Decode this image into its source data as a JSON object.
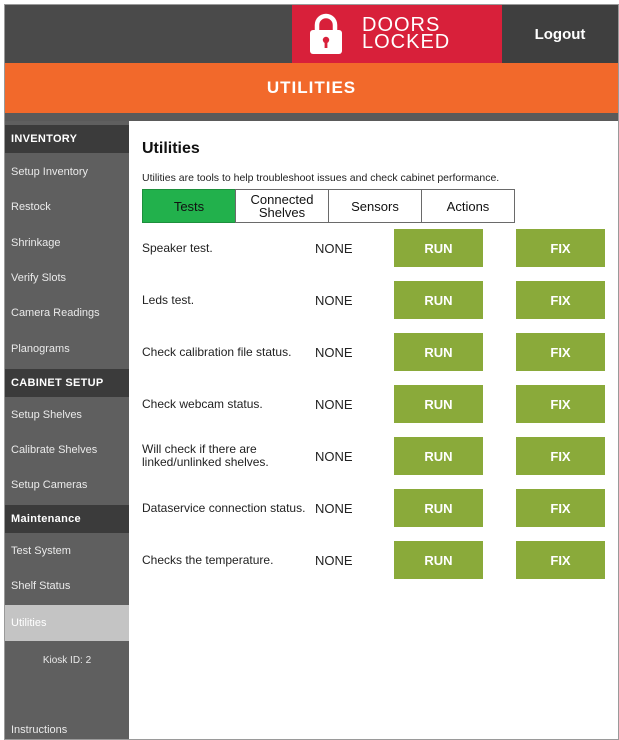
{
  "header": {
    "doors_line1": "DOORS",
    "doors_line2": "LOCKED",
    "logout_label": "Logout",
    "section_title": "UTILITIES",
    "lock_icon": "lock-icon",
    "colors": {
      "doors_bg": "#d8203a",
      "orange": "#f2692b",
      "topbar": "#4a4a4a"
    }
  },
  "sidebar": {
    "items": [
      {
        "label": "INVENTORY",
        "type": "header"
      },
      {
        "label": "Setup Inventory",
        "type": "item"
      },
      {
        "label": "Restock",
        "type": "item"
      },
      {
        "label": "Shrinkage",
        "type": "item"
      },
      {
        "label": "Verify Slots",
        "type": "item"
      },
      {
        "label": "Camera Readings",
        "type": "item"
      },
      {
        "label": "Planograms",
        "type": "item"
      },
      {
        "label": "CABINET SETUP",
        "type": "header"
      },
      {
        "label": "Setup Shelves",
        "type": "item"
      },
      {
        "label": "Calibrate Shelves",
        "type": "item"
      },
      {
        "label": "Setup Cameras",
        "type": "item"
      },
      {
        "label": "Maintenance",
        "type": "header"
      },
      {
        "label": "Test System",
        "type": "item"
      },
      {
        "label": "Shelf Status",
        "type": "item"
      },
      {
        "label": "Utilities",
        "type": "item",
        "active": true
      }
    ],
    "kiosk_label": "Kiosk ID: 2",
    "instructions_label": "Instructions"
  },
  "main": {
    "title": "Utilities",
    "description": "Utilities are tools to help troubleshoot issues and check cabinet performance.",
    "tabs": [
      {
        "label": "Tests",
        "active": true
      },
      {
        "label": "Connected Shelves",
        "active": false
      },
      {
        "label": "Sensors",
        "active": false
      },
      {
        "label": "Actions",
        "active": false
      }
    ],
    "run_label": "RUN",
    "fix_label": "FIX",
    "tests": [
      {
        "label": "Speaker test.",
        "status": "NONE"
      },
      {
        "label": "Leds test.",
        "status": "NONE"
      },
      {
        "label": "Check calibration file status.",
        "status": "NONE"
      },
      {
        "label": "Check webcam status.",
        "status": "NONE"
      },
      {
        "label": "Will check if there are linked/unlinked shelves.",
        "status": "NONE"
      },
      {
        "label": "Dataservice connection status.",
        "status": "NONE"
      },
      {
        "label": "Checks the temperature.",
        "status": "NONE"
      }
    ],
    "colors": {
      "active_tab": "#22b14c",
      "button": "#8aaa3a"
    }
  }
}
